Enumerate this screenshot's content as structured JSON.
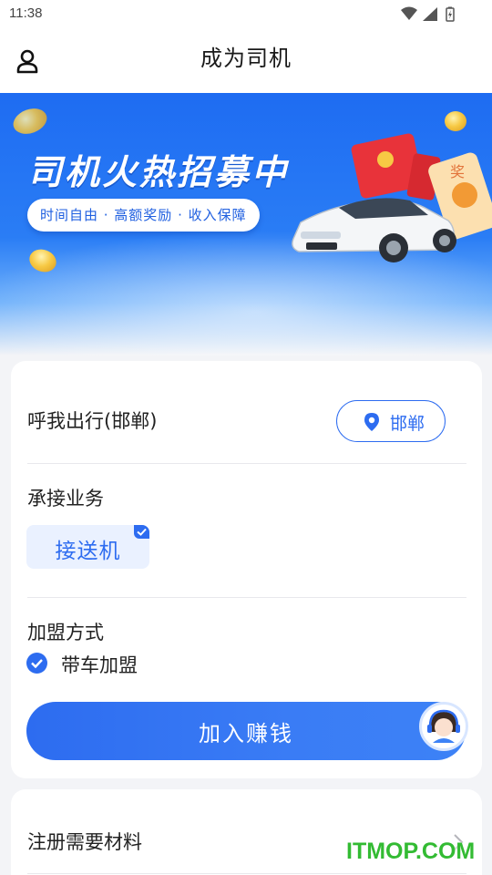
{
  "status_bar": {
    "time": "11:38"
  },
  "header": {
    "title": "成为司机"
  },
  "banner": {
    "title": "司机火热招募中",
    "tagline": "时间自由 · 高额奖励 · 收入保障",
    "envelope_text": "奖"
  },
  "city_row": {
    "label": "呼我出行(邯郸)",
    "city_button": "邯郸"
  },
  "service": {
    "label": "承接业务",
    "chip": "接送机"
  },
  "join_mode": {
    "label": "加盟方式",
    "option": "带车加盟"
  },
  "cta": {
    "label": "加入赚钱"
  },
  "materials": {
    "label": "注册需要材料"
  },
  "watermark": "ITMOP.COM",
  "colors": {
    "accent": "#2d6cf0",
    "banner_top": "#1e6cf2",
    "background": "#f3f4f7"
  }
}
